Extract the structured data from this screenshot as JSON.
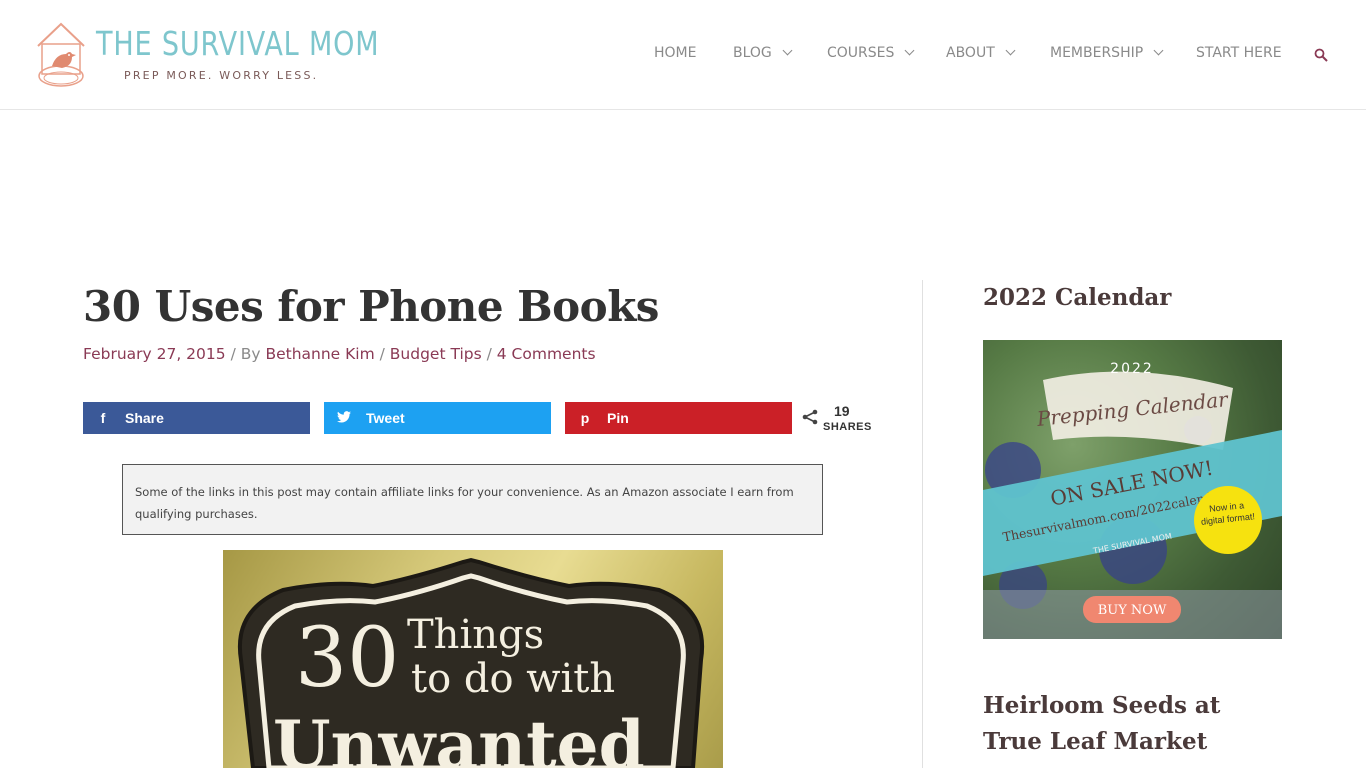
{
  "logo": {
    "title": "THE SURVIVAL MOM",
    "tagline": "PREP MORE. WORRY LESS."
  },
  "nav": {
    "items": [
      {
        "label": "HOME"
      },
      {
        "label": "BLOG"
      },
      {
        "label": "COURSES"
      },
      {
        "label": "ABOUT"
      },
      {
        "label": "MEMBERSHIP"
      },
      {
        "label": "START HERE"
      }
    ],
    "search_icon": "search-icon"
  },
  "post": {
    "title": "30 Uses for Phone Books",
    "date": "February 27, 2015",
    "sep1": " / By ",
    "author": "Bethanne Kim",
    "sep2": " / ",
    "category": "Budget Tips",
    "sep3": " / ",
    "comments": "4 Comments"
  },
  "share": {
    "facebook": {
      "label": "Share",
      "icon": "f",
      "color": "#3b5998"
    },
    "twitter": {
      "label": "Tweet",
      "icon": "twitter-icon",
      "color": "#1da1f2"
    },
    "pinterest": {
      "label": "Pin",
      "icon": "p",
      "color": "#cb2027"
    },
    "count": "19",
    "count_label": "SHARES"
  },
  "disclosure": "Some of the links in this post may contain affiliate links for your convenience. As an Amazon associate I earn from qualifying purchases.",
  "hero": {
    "line1_number": "30",
    "line1_word": "Things",
    "line2": "to do with",
    "line3": "Unwanted"
  },
  "sidebar": {
    "calendar_heading": "2022 Calendar",
    "ad": {
      "year": "2022",
      "title": "Prepping Calendar",
      "sale": "ON SALE NOW!",
      "url": "Thesurvivalmom.com/2022calendar",
      "badge": "Now in a digital format!",
      "brand": "THE SURVIVAL MOM",
      "button": "BUY NOW"
    },
    "seeds_heading": "Heirloom Seeds at True Leaf Market"
  }
}
